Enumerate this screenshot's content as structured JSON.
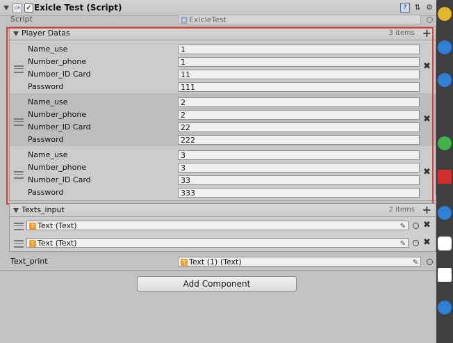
{
  "component": {
    "title": "Exicle Test (Script)",
    "script_label": "Script",
    "script_value": "ExicleTest"
  },
  "player_datas": {
    "title": "Player Datas",
    "count": "3 items",
    "elements": [
      {
        "name_use": "1",
        "number_phone": "1",
        "number_id_card": "11",
        "password": "111"
      },
      {
        "name_use": "2",
        "number_phone": "2",
        "number_id_card": "22",
        "password": "222"
      },
      {
        "name_use": "3",
        "number_phone": "3",
        "number_id_card": "33",
        "password": "333"
      }
    ],
    "field_labels": {
      "name_use": "Name_use",
      "number_phone": "Number_phone",
      "number_id_card": "Number_ID Card",
      "password": "Password"
    }
  },
  "texts_input": {
    "title": "Texts_input",
    "count": "2 items",
    "items": [
      "Text (Text)",
      "Text (Text)"
    ]
  },
  "text_print": {
    "label": "Text_print",
    "value": "Text (1) (Text)"
  },
  "add_component_label": "Add Component",
  "colors": {
    "highlight": "#e53935",
    "scrollbar": "#2a63b8"
  },
  "icons": {
    "component": "script-icon",
    "remove": "close-icon",
    "add": "plus-icon",
    "reference": "book-icon",
    "layout": "layout-icon",
    "settings": "gear-icon",
    "drag": "drag-handle-icon",
    "picker": "object-picker-icon",
    "text_object": "text-component-icon",
    "edit": "pencil-icon"
  }
}
